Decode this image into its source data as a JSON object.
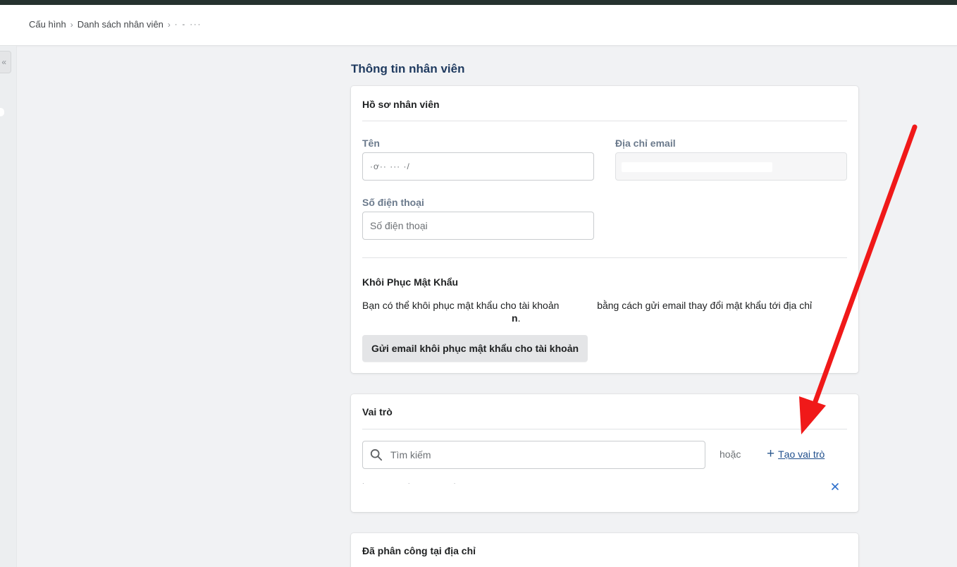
{
  "breadcrumb": {
    "item1": "Cấu hình",
    "item2": "Danh sách nhân viên",
    "item3": "· - ···"
  },
  "collapse_icon": "«",
  "page_title": "Thông tin nhân viên",
  "profile_card": {
    "title": "Hồ sơ nhân viên",
    "name_label": "Tên",
    "name_value": "·ơ·· ··· ·/",
    "email_label": "Địa chỉ email",
    "phone_label": "Số điện thoại",
    "phone_placeholder": "Số điện thoại",
    "reset_title": "Khôi Phục Mật Khẩu",
    "reset_desc_start": "Bạn có thể khôi phục mật khẩu cho tài khoản",
    "reset_desc_mid": "bằng cách gửi email thay đổi mật khẩu tới địa chỉ",
    "reset_desc_end": "n",
    "reset_button": "Gửi email khôi phục mật khẩu cho tài khoản"
  },
  "roles_card": {
    "title": "Vai trò",
    "search_placeholder": "Tìm kiếm",
    "or_text": "hoặc",
    "create_role": "Tạo vai trò",
    "role_item": "· · ·"
  },
  "assigned_card": {
    "title": "Đã phân công tại địa chỉ"
  },
  "colors": {
    "accent": "#2c6ecb",
    "annotation_arrow": "#f01919",
    "top_strip": "#26322f"
  }
}
